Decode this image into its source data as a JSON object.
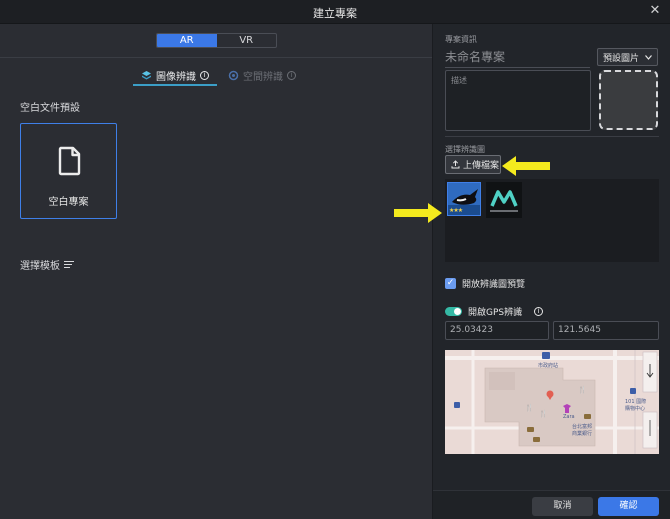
{
  "window": {
    "title": "建立專案"
  },
  "mode_switch": {
    "options": [
      "AR",
      "VR"
    ],
    "active": "AR"
  },
  "tabs": [
    {
      "label": "圖像辨識",
      "active": true
    },
    {
      "label": "空間辨識",
      "active": false
    }
  ],
  "left": {
    "blank_preset_label": "空白文件預設",
    "blank_project_label": "空白專案",
    "template_label": "選擇模板"
  },
  "right": {
    "project_info_label": "專案資訊",
    "project_name_placeholder": "未命名專案",
    "preset_image_label": "預設圖片",
    "description_placeholder": "描述",
    "select_target_label": "選擇辨識圖",
    "upload_label": "上傳檔案",
    "preview_checkbox_label": "開放辨識圖預覽",
    "gps_label": "開啟GPS辨識",
    "latitude": "25.03423",
    "longitude": "121.5645",
    "map_labels": {
      "station": "市政府站",
      "landmark_1": "101 國際",
      "landmark_2": "購物中心",
      "zara": "Zara",
      "bank_1": "台北富邦",
      "bank_2": "商業銀行"
    }
  },
  "footer": {
    "cancel_label": "取消",
    "ok_label": "確認"
  },
  "colors": {
    "accent": "#3b78e7",
    "toggle_on": "#35b9a5",
    "arrow": "#f4ea1e"
  }
}
